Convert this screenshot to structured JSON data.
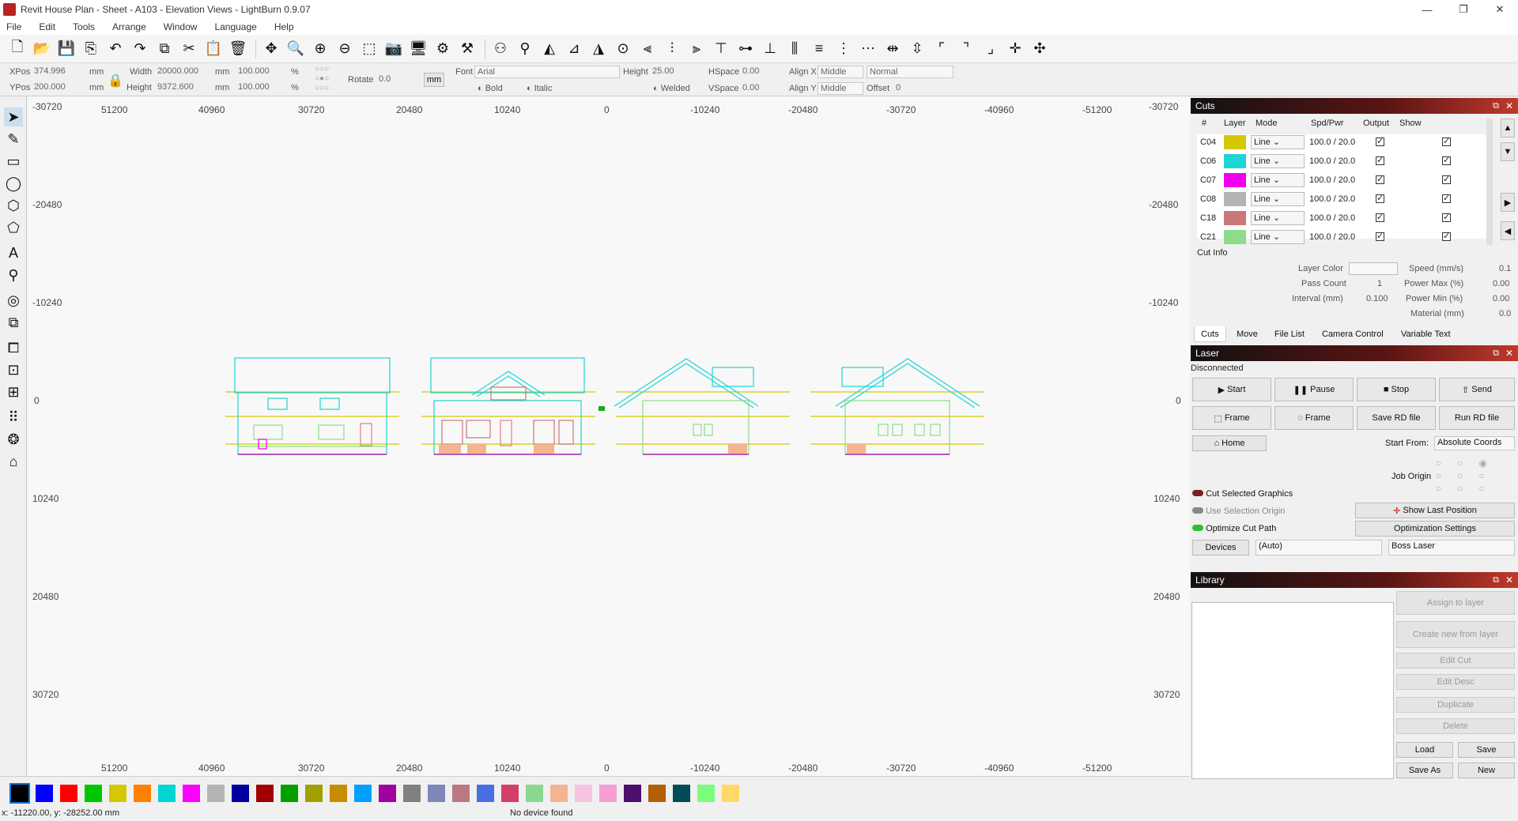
{
  "window": {
    "title": "Revit House Plan - Sheet - A103 - Elevation Views - LightBurn 0.9.07"
  },
  "menu": [
    "File",
    "Edit",
    "Tools",
    "Arrange",
    "Window",
    "Language",
    "Help"
  ],
  "props": {
    "xpos_label": "XPos",
    "xpos": "374.996",
    "ypos_label": "YPos",
    "ypos": "200.000",
    "unit": "mm",
    "width_label": "Width",
    "width": "20000.000",
    "height_label": "Height",
    "height": "9372.600",
    "scale_w": "100.000",
    "scale_h": "100.000",
    "pct": "%",
    "rotate_label": "Rotate",
    "rotate": "0.0",
    "mm_btn": "mm",
    "font_label": "Font",
    "font": "Arial",
    "fheight_label": "Height",
    "fheight": "25.00",
    "hspace_label": "HSpace",
    "hspace": "0.00",
    "vspace_label": "VSpace",
    "vspace": "0.00",
    "alignx_label": "Align X",
    "alignx": "Middle",
    "aligny_label": "Align Y",
    "aligny": "Middle",
    "normal": "Normal",
    "offset_label": "Offset",
    "offset": "0",
    "bold": "Bold",
    "italic": "Italic",
    "welded": "Welded"
  },
  "ruler": {
    "top": [
      "51200",
      "40960",
      "30720",
      "20480",
      "10240",
      "0",
      "-10240",
      "-20480",
      "-30720",
      "-40960",
      "-51200"
    ],
    "left": [
      "-30720",
      "-20480",
      "-10240",
      "0",
      "10240",
      "20480",
      "30720"
    ]
  },
  "cuts": {
    "title": "Cuts",
    "headers": [
      "#",
      "Layer",
      "Mode",
      "Spd/Pwr",
      "Output",
      "Show"
    ],
    "rows": [
      {
        "id": "C04",
        "color": "#d4c800",
        "mode": "Line",
        "spd": "100.0 / 20.0"
      },
      {
        "id": "C06",
        "color": "#1ed4d4",
        "mode": "Line",
        "spd": "100.0 / 20.0"
      },
      {
        "id": "C07",
        "color": "#f000f0",
        "mode": "Line",
        "spd": "100.0 / 20.0"
      },
      {
        "id": "C08",
        "color": "#b4b4b4",
        "mode": "Line",
        "spd": "100.0 / 20.0"
      },
      {
        "id": "C18",
        "color": "#c87878",
        "mode": "Line",
        "spd": "100.0 / 20.0"
      },
      {
        "id": "C21",
        "color": "#8cdc8c",
        "mode": "Line",
        "spd": "100.0 / 20.0"
      }
    ],
    "info_title": "Cut Info",
    "layer_color": "Layer Color",
    "pass_count": "Pass Count",
    "pass_val": "1",
    "interval": "Interval (mm)",
    "interval_val": "0.100",
    "speed": "Speed (mm/s)",
    "speed_val": "0.1",
    "pmax": "Power Max (%)",
    "pmax_val": "0.00",
    "pmin": "Power Min (%)",
    "pmin_val": "0.00",
    "material": "Material (mm)",
    "material_val": "0.0"
  },
  "tabs": [
    "Cuts",
    "Move",
    "File List",
    "Camera Control",
    "Variable Text"
  ],
  "laser": {
    "title": "Laser",
    "status": "Disconnected",
    "start": "Start",
    "pause": "Pause",
    "stop": "Stop",
    "send": "Send",
    "frame1": "Frame",
    "frame2": "Frame",
    "save_rd": "Save RD file",
    "run_rd": "Run RD file",
    "home": "Home",
    "start_from_label": "Start From:",
    "start_from": "Absolute Coords",
    "job_origin": "Job Origin",
    "cut_selected": "Cut Selected Graphics",
    "use_selection": "Use Selection Origin",
    "optimize": "Optimize Cut Path",
    "show_last": "Show Last Position",
    "opt_settings": "Optimization Settings",
    "devices": "Devices",
    "auto": "(Auto)",
    "device": "Boss Laser"
  },
  "library": {
    "title": "Library",
    "assign": "Assign to layer",
    "create": "Create new from layer",
    "edit_cut": "Edit Cut",
    "edit_desc": "Edit Desc",
    "duplicate": "Duplicate",
    "delete": "Delete",
    "load": "Load",
    "save": "Save",
    "save_as": "Save As",
    "new": "New"
  },
  "palette": [
    "#000000",
    "#0000ff",
    "#ff0000",
    "#00c800",
    "#d4c800",
    "#ff8000",
    "#00d4d4",
    "#ff00ff",
    "#b4b4b4",
    "#0000a0",
    "#a00000",
    "#00a000",
    "#a0a000",
    "#c88c00",
    "#00a0ff",
    "#a000a0",
    "#808080",
    "#7d87b9",
    "#bb7784",
    "#4a6fe3",
    "#d33f6a",
    "#8cd78f",
    "#f5b490",
    "#f6c4e1",
    "#f79cd4",
    "#4b0f6e",
    "#b45f06",
    "#014c55",
    "#7cfc7c",
    "#ffd966"
  ],
  "status": {
    "coords": "x: -11220.00, y: -28252.00 mm",
    "device": "No device found"
  }
}
